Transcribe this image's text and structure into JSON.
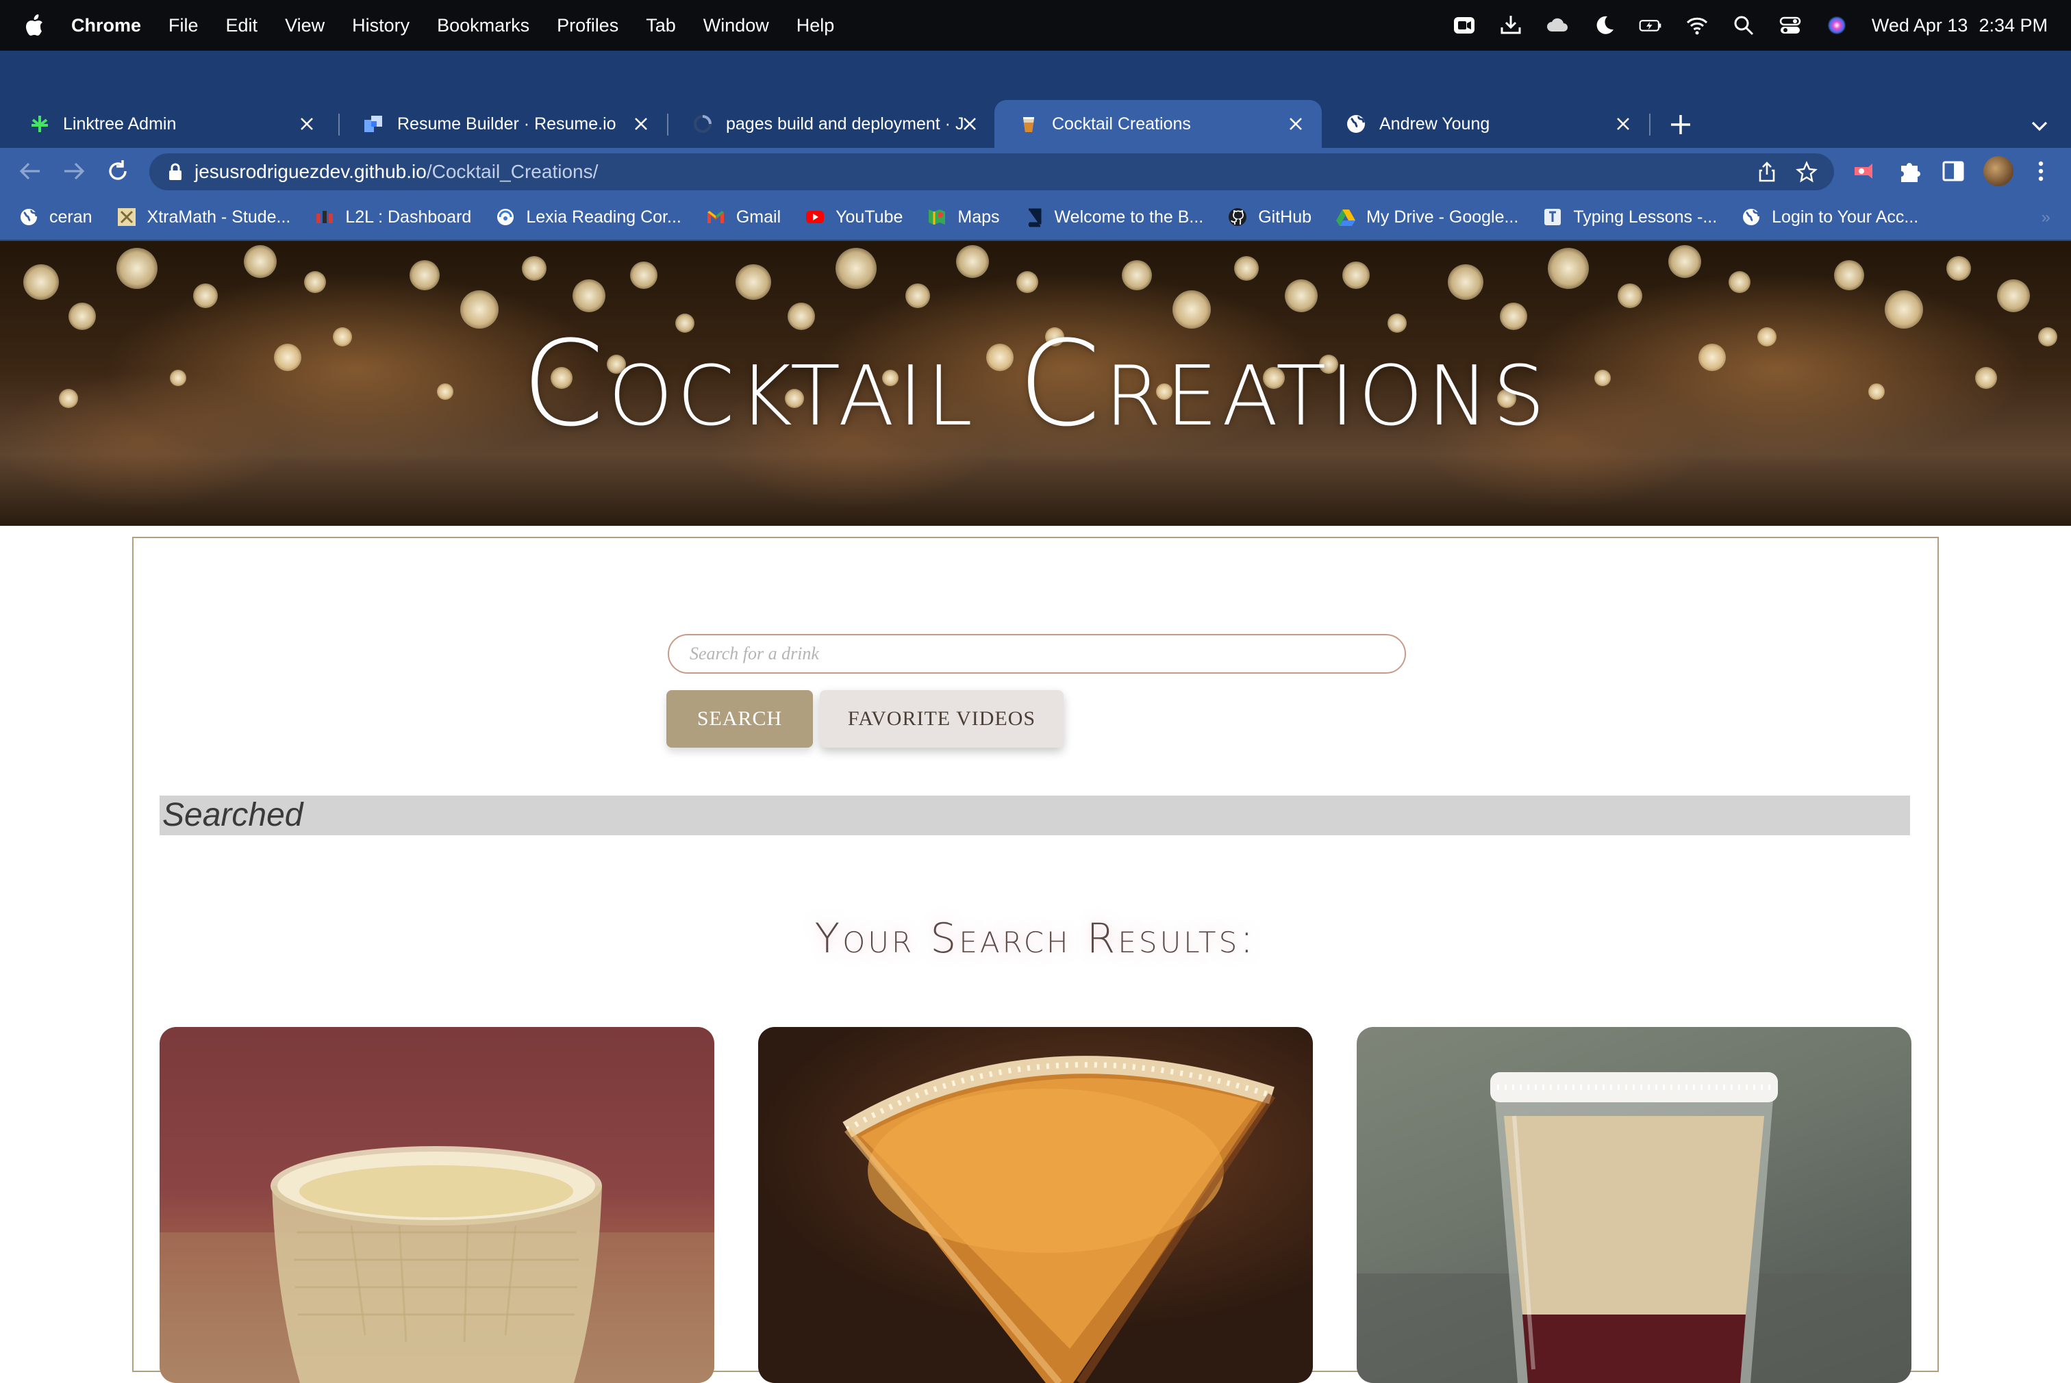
{
  "menubar": {
    "app_name": "Chrome",
    "menus": [
      "File",
      "Edit",
      "View",
      "History",
      "Bookmarks",
      "Profiles",
      "Tab",
      "Window",
      "Help"
    ],
    "date": "Wed Apr 13",
    "time": "2:34 PM",
    "status_icons": [
      "zoom-icon",
      "download-icon",
      "cloud-icon",
      "moon-icon",
      "battery-icon",
      "wifi-icon",
      "spotlight-icon",
      "control-center-icon",
      "siri-icon"
    ]
  },
  "tabs": [
    {
      "title": "Linktree Admin",
      "icon": "linktree-icon",
      "active": false
    },
    {
      "title": "Resume Builder · Resume.io",
      "icon": "resume-icon",
      "active": false
    },
    {
      "title": "pages build and deployment · J",
      "icon": "loading-icon",
      "active": false
    },
    {
      "title": "Cocktail Creations",
      "icon": "cocktail-icon",
      "active": true
    },
    {
      "title": "Andrew Young",
      "icon": "globe-icon",
      "active": false
    }
  ],
  "address_bar": {
    "host": "jesusrodriguezdev.github.io",
    "path": "/Cocktail_Creations/"
  },
  "bookmarks": [
    {
      "label": "ceran",
      "icon": "globe-icon"
    },
    {
      "label": "XtraMath - Stude...",
      "icon": "xtramath-icon"
    },
    {
      "label": "L2L : Dashboard",
      "icon": "l2l-icon"
    },
    {
      "label": "Lexia Reading Cor...",
      "icon": "lexia-icon"
    },
    {
      "label": "Gmail",
      "icon": "gmail-icon"
    },
    {
      "label": "YouTube",
      "icon": "youtube-icon"
    },
    {
      "label": "Maps",
      "icon": "maps-icon"
    },
    {
      "label": "Welcome to the B...",
      "icon": "book-icon"
    },
    {
      "label": "GitHub",
      "icon": "github-icon"
    },
    {
      "label": "My Drive - Google...",
      "icon": "drive-icon"
    },
    {
      "label": "Typing Lessons -...",
      "icon": "typing-icon"
    },
    {
      "label": "Login to Your Acc...",
      "icon": "globe-icon"
    }
  ],
  "bookmarks_overflow": "»",
  "page": {
    "hero_title": "Cocktail Creations",
    "search": {
      "placeholder": "Search for a drink",
      "value": ""
    },
    "search_button": "SEARCH",
    "videos_button": "FAVORITE VIDEOS",
    "searched_label": "Searched",
    "results_heading": "Your Search Results:",
    "cards": [
      {
        "image": "cocktail-rocks-glass-photo"
      },
      {
        "image": "cocktail-martini-sugar-rim-photo"
      },
      {
        "image": "cocktail-layered-shot-photo"
      }
    ]
  },
  "colors": {
    "menubar_bg": "#0b0d10",
    "tabstrip_bg": "#1d3d72",
    "toolbar_bg": "#3760a6",
    "frame_border": "#b39f7f",
    "search_button_bg": "#b09f7f",
    "videos_button_bg": "#e8e3e0",
    "searched_bar_bg": "#d3d3d3"
  }
}
